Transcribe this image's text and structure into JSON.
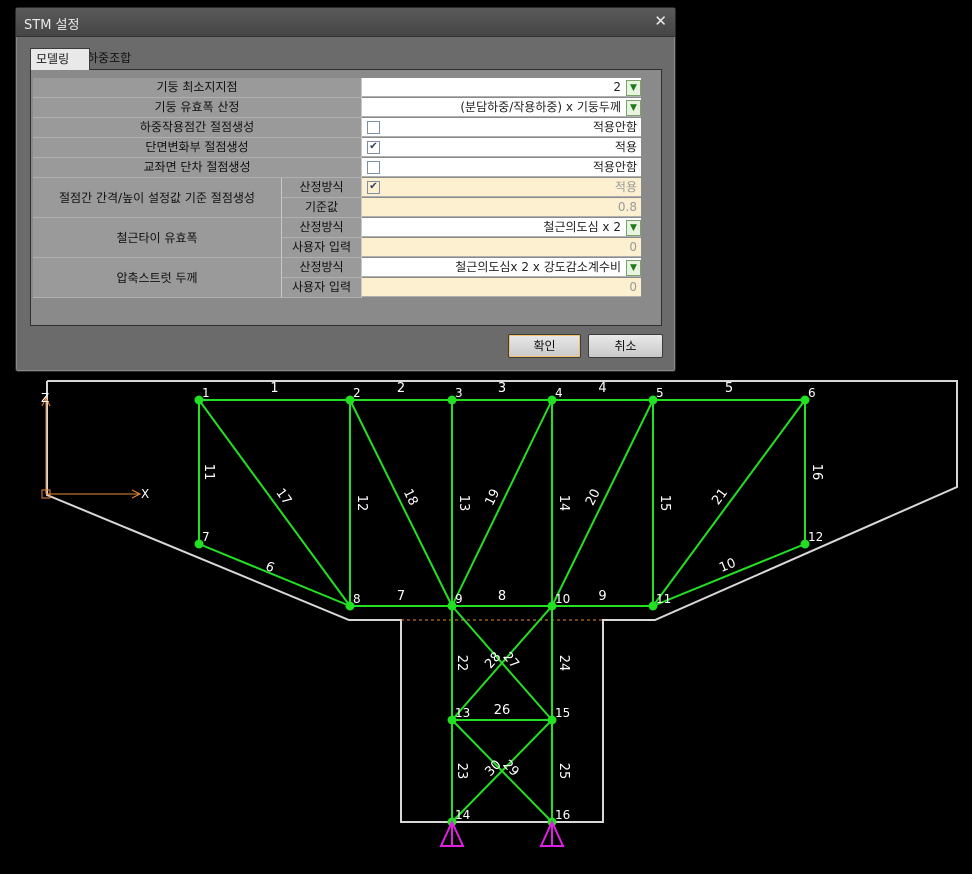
{
  "dialog": {
    "title": "STM 설정",
    "close_icon": "close-icon",
    "tabs": [
      {
        "label": "모델링",
        "active": true
      },
      {
        "label": "하중조합",
        "active": false
      }
    ],
    "rows": [
      {
        "label": "기둥 최소지지점",
        "value": "2",
        "control": "dropdown"
      },
      {
        "label": "기둥 유효폭 산정",
        "value": "(분담하중/작용하중) x 기둥두께",
        "control": "dropdown"
      },
      {
        "label": "하중작용점간 절점생성",
        "value": "적용안함",
        "control": "checkbox",
        "checked": false
      },
      {
        "label": "단면변화부 절점생성",
        "value": "적용",
        "control": "checkbox",
        "checked": true
      },
      {
        "label": "교좌면 단차 절점생성",
        "value": "적용안함",
        "control": "checkbox",
        "checked": false
      }
    ],
    "groups": [
      {
        "label": "절점간 간격/높이 설정값 기준 절점생성",
        "sub": [
          {
            "label": "산정방식",
            "value": "적용",
            "control": "checkbox",
            "checked": true,
            "disabled": true
          },
          {
            "label": "기준값",
            "value": "0.8",
            "disabled": true
          }
        ]
      },
      {
        "label": "철근타이 유효폭",
        "sub": [
          {
            "label": "산정방식",
            "value": "철근의도심 x 2",
            "control": "dropdown"
          },
          {
            "label": "사용자 입력",
            "value": "0",
            "disabled": true
          }
        ]
      },
      {
        "label": "압축스트럿 두께",
        "sub": [
          {
            "label": "산정방식",
            "value": "철근의도심x 2 x 강도감소계수비",
            "control": "dropdown"
          },
          {
            "label": "사용자 입력",
            "value": "0",
            "disabled": true
          }
        ]
      }
    ],
    "buttons": {
      "ok": "확인",
      "cancel": "취소"
    },
    "colors": {
      "accent_check": "#2b3d6a",
      "tan": "#fdf0d0",
      "dropdown_arrow": "#1e7a1e"
    }
  },
  "model": {
    "axis_labels": {
      "z": "Z",
      "x": "X"
    },
    "colors": {
      "outline": "#d8d8d8",
      "member": "#22e022",
      "node": "#22e022",
      "label": "#ffffff",
      "axis": "#e8873a",
      "support": "#e020e0",
      "dashed_line": "#e8873a"
    },
    "node_labels": [
      "1",
      "2",
      "3",
      "4",
      "5",
      "6",
      "7",
      "8",
      "9",
      "10",
      "11",
      "12",
      "13",
      "14",
      "15",
      "16"
    ],
    "member_labels": [
      "1",
      "2",
      "3",
      "4",
      "5",
      "6",
      "7",
      "8",
      "9",
      "10",
      "11",
      "12",
      "13",
      "14",
      "15",
      "16",
      "17",
      "18",
      "19",
      "20",
      "21",
      "22",
      "23",
      "24",
      "25",
      "26",
      "27",
      "28",
      "29",
      "30"
    ]
  }
}
